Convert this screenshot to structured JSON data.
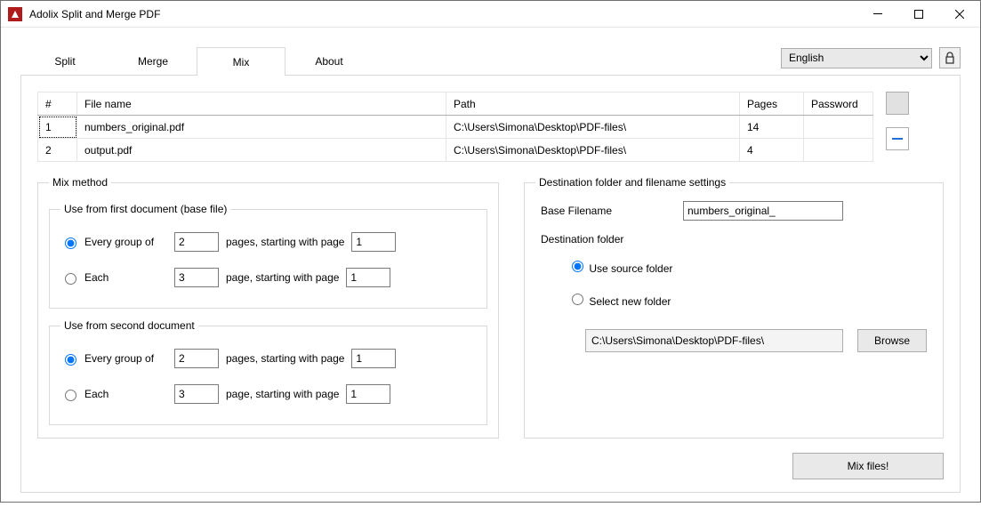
{
  "window": {
    "title": "Adolix Split and Merge PDF"
  },
  "tabs": {
    "split": "Split",
    "merge": "Merge",
    "mix": "Mix",
    "about": "About",
    "active": "mix"
  },
  "language": {
    "selected": "English",
    "options": [
      "English"
    ]
  },
  "file_table": {
    "headers": {
      "num": "#",
      "file": "File name",
      "path": "Path",
      "pages": "Pages",
      "pwd": "Password"
    },
    "rows": [
      {
        "num": "1",
        "file": "numbers_original.pdf",
        "path": "C:\\Users\\Simona\\Desktop\\PDF-files\\",
        "pages": "14",
        "pwd": ""
      },
      {
        "num": "2",
        "file": "output.pdf",
        "path": "C:\\Users\\Simona\\Desktop\\PDF-files\\",
        "pages": "4",
        "pwd": ""
      }
    ]
  },
  "mix": {
    "legend": "Mix method",
    "first": {
      "legend": "Use from first document (base file)",
      "every_label": "Every group of",
      "every_n": "2",
      "every_mid": "pages, starting with page",
      "every_start": "1",
      "each_label": "Each",
      "each_n": "3",
      "each_mid": "page, starting with page",
      "each_start": "1"
    },
    "second": {
      "legend": "Use from second document",
      "every_label": "Every group of",
      "every_n": "2",
      "every_mid": "pages, starting with page",
      "every_start": "1",
      "each_label": "Each",
      "each_n": "3",
      "each_mid": "page, starting with page",
      "each_start": "1"
    }
  },
  "dest": {
    "legend": "Destination folder and filename settings",
    "base_label": "Base Filename",
    "base_value": "numbers_original_",
    "folder_label": "Destination folder",
    "use_source": "Use source folder",
    "select_new": "Select new folder",
    "path": "C:\\Users\\Simona\\Desktop\\PDF-files\\",
    "browse": "Browse"
  },
  "go": "Mix files!"
}
